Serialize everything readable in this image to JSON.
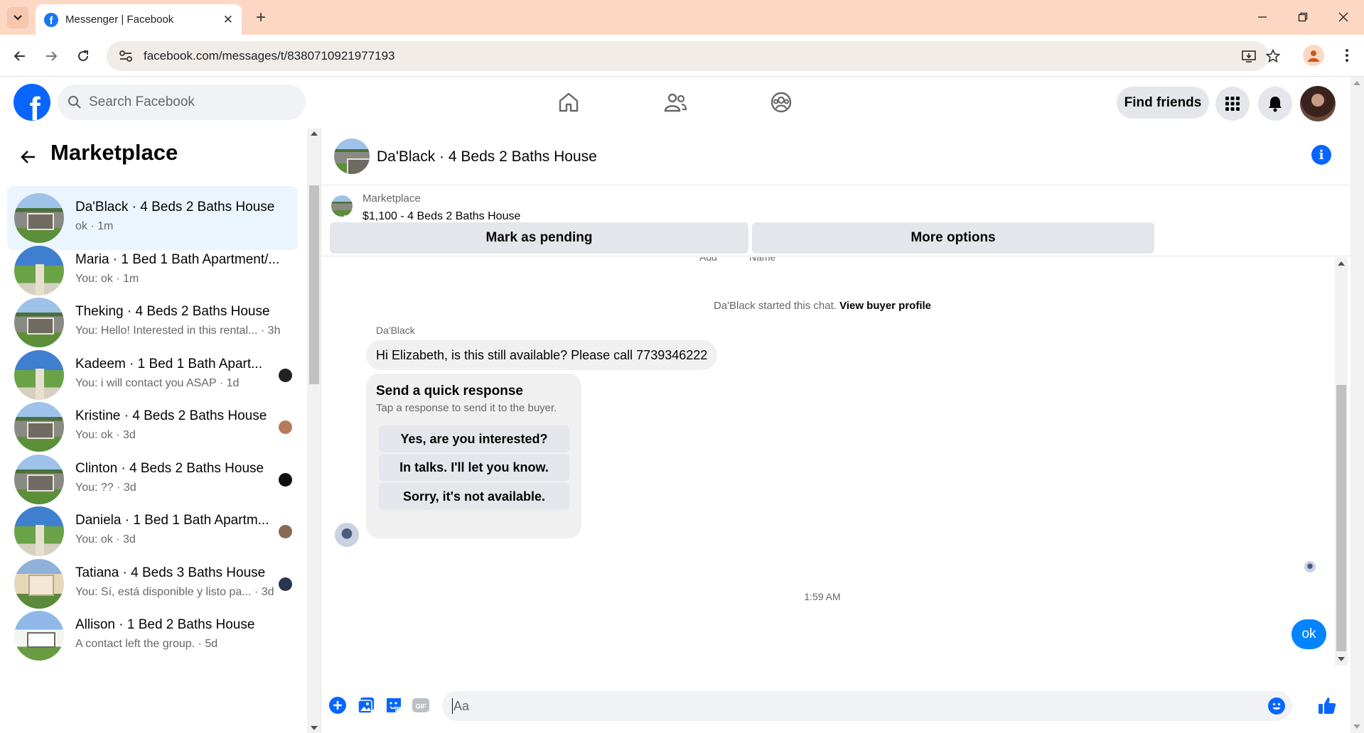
{
  "browser": {
    "tab_title": "Messenger | Facebook",
    "url": "facebook.com/messages/t/8380710921977193"
  },
  "header": {
    "search_placeholder": "Search Facebook",
    "find_friends": "Find friends"
  },
  "sidebar": {
    "title": "Marketplace",
    "conversations": [
      {
        "name": "Da'Black · 4 Beds 2 Baths House",
        "preview": "ok · 1m",
        "thumb": "house",
        "active": true
      },
      {
        "name": "Maria · 1 Bed 1 Bath Apartment/...",
        "preview": "You: ok · 1m",
        "thumb": "apt"
      },
      {
        "name": "Theking · 4 Beds 2 Baths House",
        "preview": "You: Hello! Interested in this rental... · 3h",
        "thumb": "house"
      },
      {
        "name": "Kadeem · 1 Bed 1 Bath Apart...",
        "preview": "You: i will contact you ASAP · 1d",
        "thumb": "apt",
        "mini": "#222222"
      },
      {
        "name": "Kristine · 4 Beds 2 Baths House",
        "preview": "You: ok · 3d",
        "thumb": "house",
        "mini": "#b87a5a"
      },
      {
        "name": "Clinton · 4 Beds 2 Baths House",
        "preview": "You: ?? · 3d",
        "thumb": "house",
        "mini": "#111111"
      },
      {
        "name": "Daniela · 1 Bed 1 Bath Apartm...",
        "preview": "You: ok · 3d",
        "thumb": "apt",
        "mini": "#8a6a55"
      },
      {
        "name": "Tatiana · 4 Beds 3 Baths House",
        "preview": "You: Sí, está disponible y listo pa... · 3d",
        "thumb": "tan",
        "mini": "#2a3550"
      },
      {
        "name": "Allison · 1 Bed 2 Baths House",
        "preview": "A contact left the group. · 5d",
        "thumb": "white"
      }
    ]
  },
  "chat": {
    "title": "Da'Black · 4 Beds 2 Baths House",
    "marketplace_label": "Marketplace",
    "listing": "$1,100 - 4 Beds 2 Baths House",
    "mark_pending": "Mark as pending",
    "more_options": "More options",
    "cut_left": "Add",
    "cut_right": "Name",
    "system_text": "Da'Black started this chat.",
    "system_link": "View buyer profile",
    "sender": "Da'Black",
    "incoming_message": "Hi Elizabeth, is this still available? Please call 7739346222",
    "quick_title": "Send a quick response",
    "quick_subtitle": "Tap a response to send it to the buyer.",
    "quick_responses": [
      "Yes, are you interested?",
      "In talks. I'll let you know.",
      "Sorry, it's not available."
    ],
    "timestamp": "1:59 AM",
    "outgoing_message": "ok",
    "composer_placeholder": "Aa"
  },
  "colors": {
    "brand": "#0866ff",
    "outgoing_bubble": "#0084ff",
    "active_row": "#ebf5ff",
    "tabbar": "#fcd8c4"
  }
}
